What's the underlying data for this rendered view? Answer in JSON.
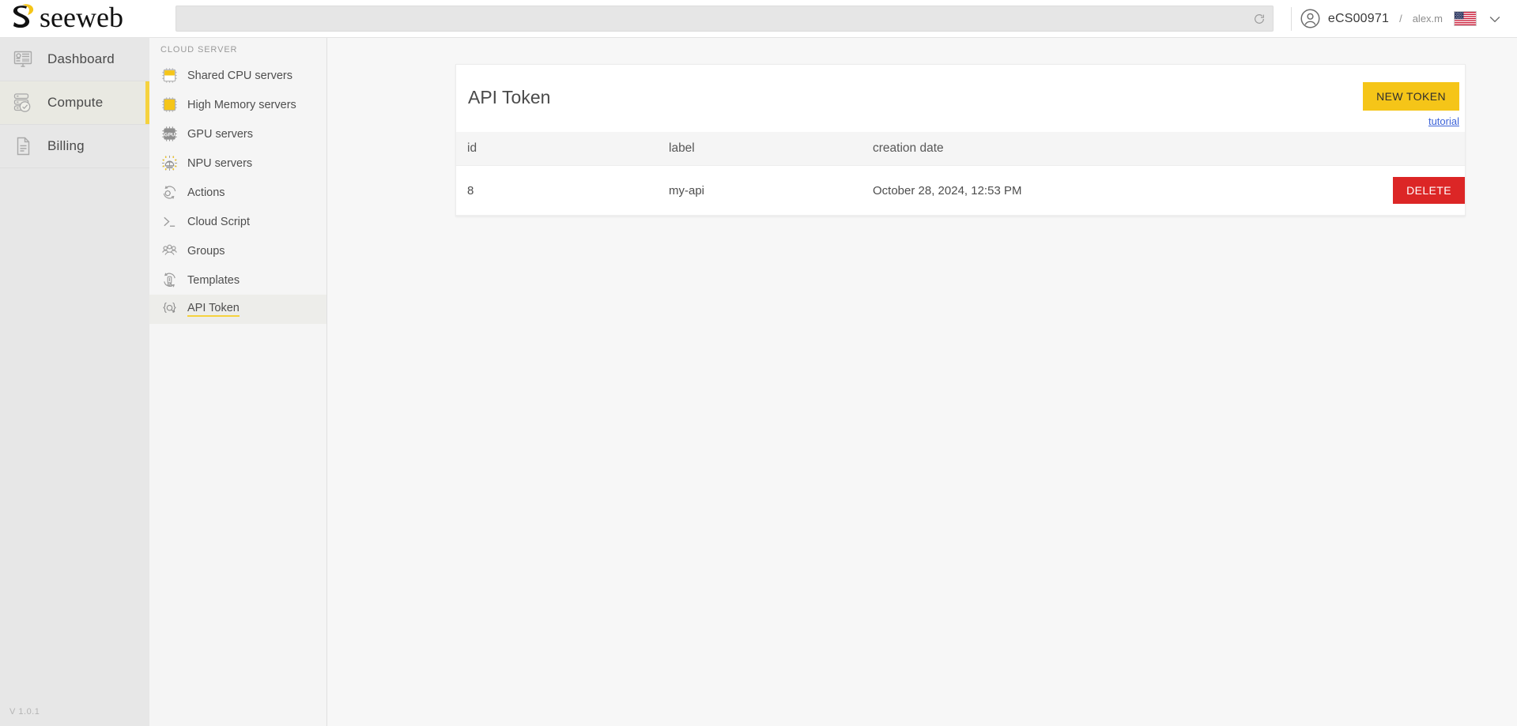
{
  "brand": {
    "name": "seeweb",
    "accent_yellow": "#F5C518",
    "accent_bar": "#F5D23E"
  },
  "topbar": {
    "search": {
      "value": "",
      "placeholder": ""
    },
    "refresh_icon": "refresh-icon",
    "user": {
      "avatar_icon": "user-avatar-icon",
      "account": "eCS00971",
      "separator": "/",
      "username": "alex.m",
      "flag": "us-flag",
      "chevron_icon": "chevron-down-icon"
    }
  },
  "sidebar": {
    "items": [
      {
        "label": "Dashboard",
        "icon": "dashboard-icon",
        "active": false
      },
      {
        "label": "Compute",
        "icon": "server-check-icon",
        "active": true
      },
      {
        "label": "Billing",
        "icon": "document-icon",
        "active": false
      }
    ],
    "version": "V 1.0.1"
  },
  "subnav": {
    "title": "CLOUD SERVER",
    "items": [
      {
        "label": "Shared CPU servers",
        "icon": "cpu-chip-half-icon",
        "active": false
      },
      {
        "label": "High Memory servers",
        "icon": "cpu-chip-full-icon",
        "active": false
      },
      {
        "label": "GPU servers",
        "icon": "gpu-chip-icon",
        "active": false
      },
      {
        "label": "NPU servers",
        "icon": "npu-chip-icon",
        "active": false
      },
      {
        "label": "Actions",
        "icon": "actions-gear-icon",
        "active": false
      },
      {
        "label": "Cloud Script",
        "icon": "terminal-icon",
        "active": false
      },
      {
        "label": "Groups",
        "icon": "groups-icon",
        "active": false
      },
      {
        "label": "Templates",
        "icon": "templates-icon",
        "active": false
      },
      {
        "label": "API Token",
        "icon": "api-token-icon",
        "active": true
      }
    ],
    "collapse_icon": "double-chevron-left-icon"
  },
  "main": {
    "card_title": "API Token",
    "new_token_label": "NEW TOKEN",
    "tutorial_label": "tutorial",
    "table": {
      "columns": [
        "id",
        "label",
        "creation date",
        ""
      ],
      "rows": [
        {
          "id": "8",
          "label": "my-api",
          "creation_date": "October 28, 2024, 12:53 PM",
          "action_label": "DELETE"
        }
      ]
    },
    "delete_color": "#DC2626"
  }
}
